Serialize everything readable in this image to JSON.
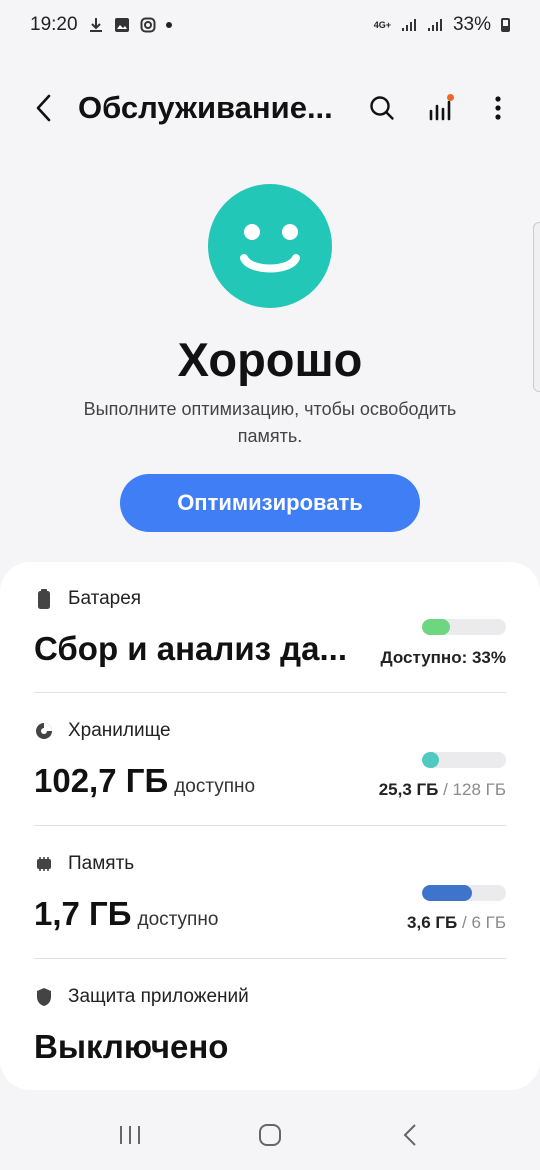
{
  "status_bar": {
    "time": "19:20",
    "network": "4G+",
    "battery_percent": "33%"
  },
  "header": {
    "title": "Обслуживание..."
  },
  "hero": {
    "status": "Хорошо",
    "description": "Выполните оптимизацию, чтобы освободить память.",
    "optimize_label": "Оптимизировать"
  },
  "battery": {
    "label": "Батарея",
    "value": "Сбор и анализ да...",
    "stat": "Доступно: 33%",
    "level": 0.33,
    "color": "#6dd680"
  },
  "storage": {
    "label": "Хранилище",
    "value": "102,7 ГБ",
    "value_suffix": "доступно",
    "used": "25,3 ГБ",
    "total": "/ 128 ГБ",
    "level": 0.198,
    "color": "#4ecac0"
  },
  "memory": {
    "label": "Память",
    "value": "1,7 ГБ",
    "value_suffix": "доступно",
    "used": "3,6 ГБ",
    "total": "/ 6 ГБ",
    "level": 0.6,
    "color": "#3f74cc"
  },
  "app_protection": {
    "label": "Защита приложений",
    "value": "Выключено"
  },
  "colors": {
    "accent": "#3f7ef5",
    "smiley": "#22c7b8"
  }
}
